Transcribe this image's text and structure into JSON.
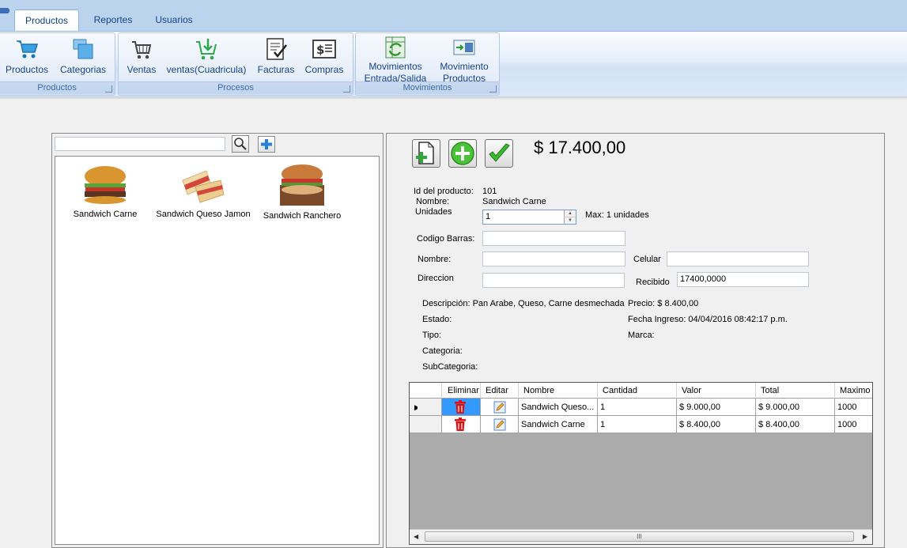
{
  "ribbon": {
    "tabs": [
      {
        "label": "Productos",
        "active": true
      },
      {
        "label": "Reportes",
        "active": false
      },
      {
        "label": "Usuarios",
        "active": false
      }
    ],
    "groups": {
      "productos": {
        "caption": "Productos",
        "buttons": [
          {
            "label": "Productos",
            "icon": "cart-icon"
          },
          {
            "label": "Categorias",
            "icon": "folders-icon"
          }
        ]
      },
      "procesos": {
        "caption": "Procesos",
        "buttons": [
          {
            "label": "Ventas",
            "icon": "shopping-basket-icon"
          },
          {
            "label": "ventas(Cuadricula)",
            "icon": "cart-download-icon"
          },
          {
            "label": "Facturas",
            "icon": "invoice-check-icon"
          },
          {
            "label": "Compras",
            "icon": "dollar-document-icon"
          }
        ]
      },
      "movimientos": {
        "caption": "Movimientos",
        "buttons": [
          {
            "label_line1": "Movimientos",
            "label_line2": "Entrada/Salida",
            "icon": "spreadsheet-refresh-icon"
          },
          {
            "label_line1": "Movimiento",
            "label_line2": "Productos",
            "icon": "transfer-icon"
          }
        ]
      }
    }
  },
  "search": {
    "value": ""
  },
  "products": [
    {
      "name": "Sandwich Carne"
    },
    {
      "name": "Sandwich Queso Jamon"
    },
    {
      "name": "Sandwich Ranchero"
    }
  ],
  "sale": {
    "total": "$ 17.400,00",
    "id_label": "Id del producto:",
    "id_value": "101",
    "name_label": "Nombre:",
    "name_value": "Sandwich Carne",
    "units_label": "Unidades",
    "units_value": "1",
    "max_text": "Max: 1 unidades"
  },
  "form": {
    "codigo_barras_label": "Codigo Barras:",
    "codigo_barras_value": "",
    "nombre_label": "Nombre:",
    "nombre_value": "",
    "celular_label": "Celular",
    "celular_value": "",
    "direccion_label": "Direccion",
    "direccion_value": "",
    "recibido_label": "Recibido",
    "recibido_value": "17400,0000"
  },
  "details": {
    "descripcion": "Descripción: Pan Arabe, Queso, Carne desmechada",
    "estado": "Estado:",
    "tipo": "Tipo:",
    "categoria": "Categoria:",
    "subcategoria": "SubCategoria:",
    "precio": "Precio: $ 8.400,00",
    "fecha_ingreso": "Fecha Ingreso: 04/04/2016 08:42:17 p.m.",
    "marca": "Marca:"
  },
  "grid": {
    "columns": [
      "Eliminar",
      "Editar",
      "Nombre",
      "Cantidad",
      "Valor",
      "Total",
      "Maximo"
    ],
    "rows": [
      {
        "nombre": "Sandwich Queso...",
        "cantidad": "1",
        "valor": "$ 9.000,00",
        "total": "$ 9.000,00",
        "maximo": "1000"
      },
      {
        "nombre": "Sandwich Carne",
        "cantidad": "1",
        "valor": "$ 8.400,00",
        "total": "$ 8.400,00",
        "maximo": "1000"
      }
    ],
    "scroll_thumb": "III"
  }
}
